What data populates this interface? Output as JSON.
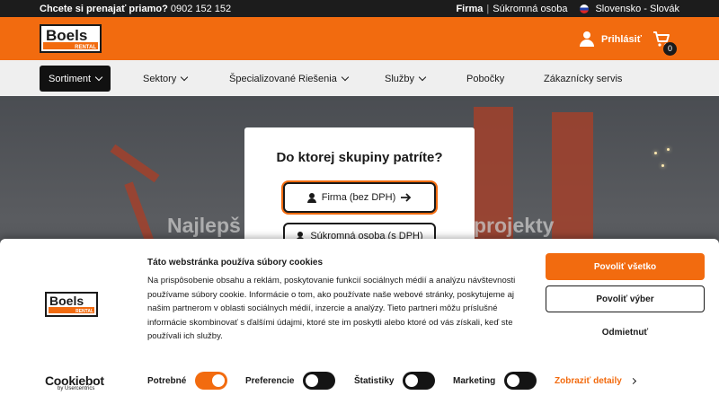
{
  "topbar": {
    "rent_prompt": "Chcete si prenajať priamo?",
    "phone": "0902 152 152",
    "business": "Firma",
    "separator": "|",
    "private": "Súkromná osoba",
    "region": "Slovensko - Slovák"
  },
  "header": {
    "logo_word": "Boels",
    "logo_sub": "RENTAL",
    "login_label": "Prihlásiť",
    "cart_count": "0"
  },
  "nav": {
    "items": [
      {
        "label": "Sortiment"
      },
      {
        "label": "Sektory"
      },
      {
        "label": "Špecializované Riešenia"
      },
      {
        "label": "Služby"
      },
      {
        "label": "Pobočky"
      },
      {
        "label": "Zákaznícky servis"
      }
    ]
  },
  "hero": {
    "title_left": "Najlepš",
    "title_right": "projekty"
  },
  "modal": {
    "title": "Do ktorej skupiny patríte?",
    "business_button": "Firma (bez DPH)",
    "private_button": "Súkromná osoba (s DPH)"
  },
  "cookie": {
    "heading": "Táto webstránka používa súbory cookies",
    "body": "Na prispôsobenie obsahu a reklám, poskytovanie funkcií sociálnych médií a analýzu návštevnosti používame súbory cookie. Informácie o tom, ako používate naše webové stránky, poskytujeme aj našim partnerom v oblasti sociálnych médií, inzercie a analýzy. Tieto partneri môžu príslušné informácie skombinovať s ďalšími údajmi, ktoré ste im poskytli alebo ktoré od vás získali, keď ste používali ich služby.",
    "allow_all": "Povoliť všetko",
    "allow_selection": "Povoliť výber",
    "deny": "Odmietnuť",
    "cookiebot_name": "Cookiebot",
    "cookiebot_by": "by Usercentrics",
    "toggles": [
      {
        "label": "Potrebné",
        "on": true
      },
      {
        "label": "Preferencie",
        "on": false
      },
      {
        "label": "Štatistiky",
        "on": false
      },
      {
        "label": "Marketing",
        "on": false
      }
    ],
    "details_link": "Zobraziť detaily"
  },
  "colors": {
    "brand_orange": "#f26b0f",
    "dark": "#1a1a1a"
  }
}
